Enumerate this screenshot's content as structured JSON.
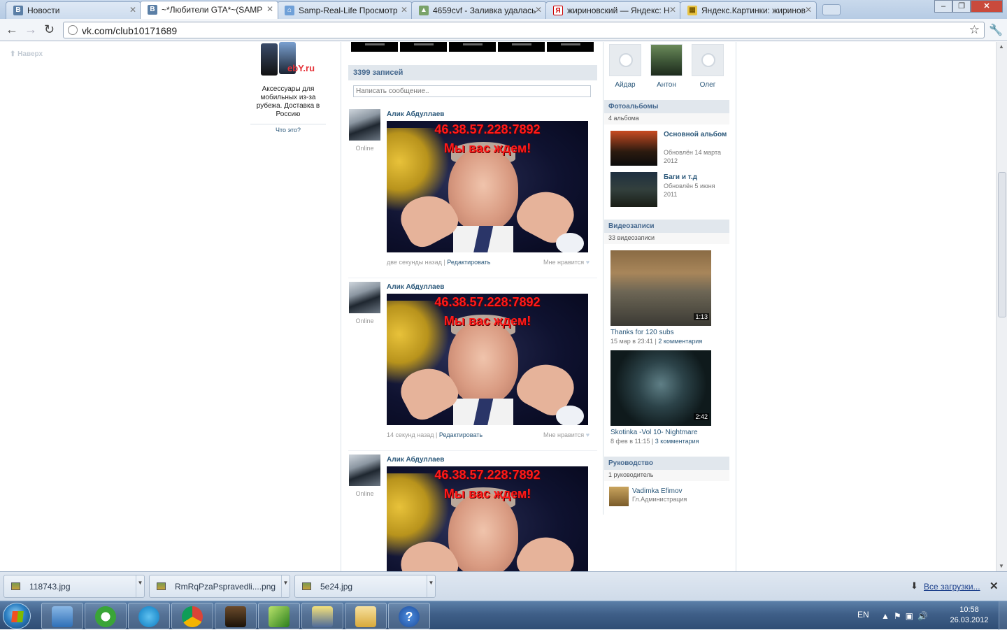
{
  "browser": {
    "tabs": [
      {
        "label": "Новости",
        "icon": "vk-favicon"
      },
      {
        "label": "~*Любители GTA*~(SAMP",
        "icon": "vk-favicon",
        "active": true
      },
      {
        "label": "Samp-Real-Life Просмотр",
        "icon": "house-favicon"
      },
      {
        "label": "4659cvf - Заливка удалась",
        "icon": "image-favicon"
      },
      {
        "label": "жириновский — Яндекс: Н",
        "icon": "yandex-favicon"
      },
      {
        "label": "Яндекс.Картинки: жиринов",
        "icon": "yandex-images-favicon"
      }
    ],
    "url": "vk.com/club10171689"
  },
  "page": {
    "scroll_top_label": "Наверх",
    "ad": {
      "brand": "ebY.ru",
      "text": "Аксессуары для мобильных из-за рубежа. Доставка в Россию",
      "what_is_this": "Что это?"
    },
    "wall": {
      "count_label": "3399 записей",
      "composer_placeholder": "Написать сообщение..",
      "posts": [
        {
          "author": "Алик Абдуллаев",
          "status": "Online",
          "image_line1": "46.38.57.228:7892",
          "image_line2": "Мы вас ждем!",
          "time": "две секунды назад",
          "edit": "Редактировать",
          "like": "Мне нравится"
        },
        {
          "author": "Алик Абдуллаев",
          "status": "Online",
          "image_line1": "46.38.57.228:7892",
          "image_line2": "Мы вас ждем!",
          "time": "14 секунд назад",
          "edit": "Редактировать",
          "like": "Мне нравится"
        },
        {
          "author": "Алик Абдуллаев",
          "status": "Online",
          "image_line1": "46.38.57.228:7892",
          "image_line2": "Мы вас ждем!"
        }
      ]
    },
    "members": [
      {
        "name": "Айдар"
      },
      {
        "name": "Антон"
      },
      {
        "name": "Олег"
      }
    ],
    "photo_albums": {
      "title": "Фотоальбомы",
      "count": "4 альбома",
      "items": [
        {
          "title": "Основной альбом",
          "updated": "Обновлён 14 марта 2012"
        },
        {
          "title": "Баги и т.д",
          "updated": "Обновлён 5 июня 2011"
        }
      ]
    },
    "videos": {
      "title": "Видеозаписи",
      "count": "33 видеозаписи",
      "items": [
        {
          "title": "Thanks for 120 subs",
          "duration": "1:13",
          "date": "15 мар в 23:41",
          "comments": "2 комментария"
        },
        {
          "title": "Skotinka -Vol 10- Nightmare",
          "duration": "2:42",
          "date": "8 фев в 11:15",
          "comments": "3 комментария"
        }
      ]
    },
    "management": {
      "title": "Руководство",
      "count": "1 руководитель",
      "leader_name": "Vadimka Efimov",
      "leader_role": "Гл.Администрация"
    }
  },
  "downloads": {
    "items": [
      "118743.jpg",
      "RmRqPzaPspravedli....png",
      "5e24.jpg"
    ],
    "all_label": "Все загрузки..."
  },
  "taskbar": {
    "language": "EN",
    "time": "10:58",
    "date": "26.03.2012"
  }
}
